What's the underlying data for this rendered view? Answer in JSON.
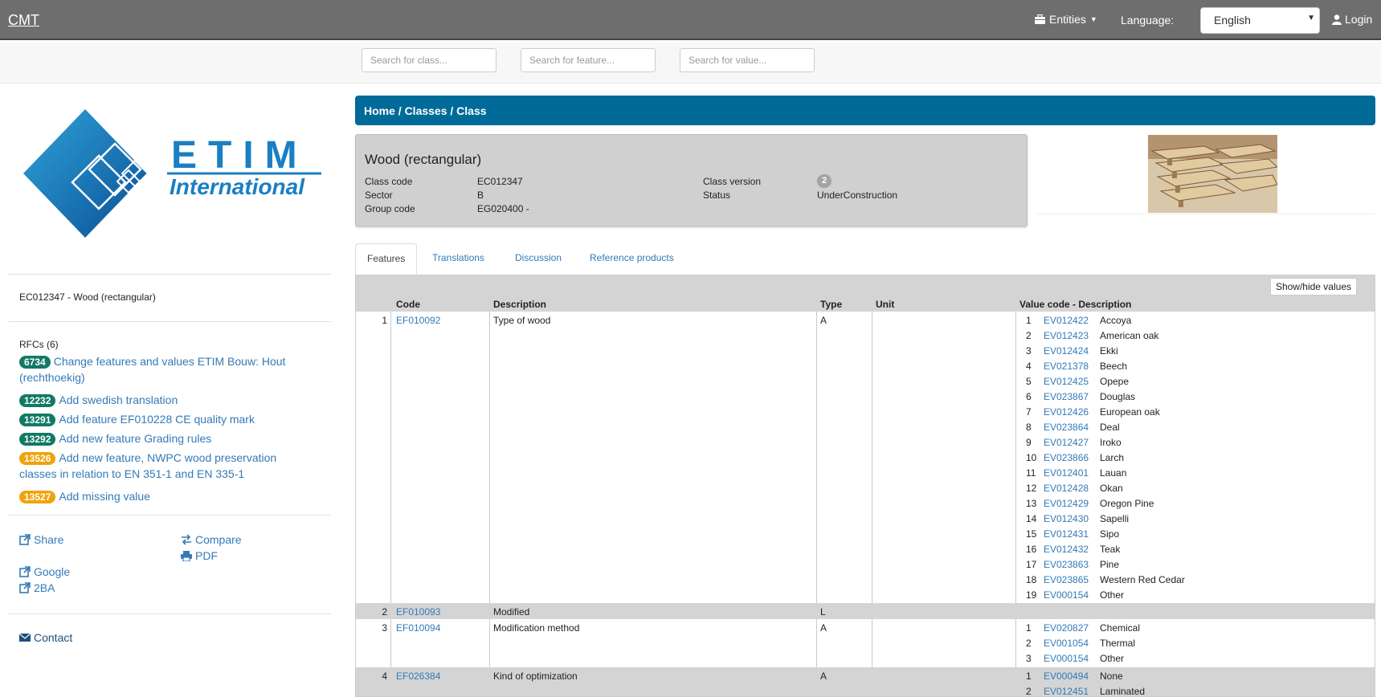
{
  "navbar": {
    "brand": "CMT",
    "entities_label": "Entities",
    "language_label": "Language:",
    "language_value": "English",
    "login_label": "Login"
  },
  "search": {
    "class_placeholder": "Search for class...",
    "feature_placeholder": "Search for feature...",
    "value_placeholder": "Search for value..."
  },
  "sidebar": {
    "logo_text_top": "ETIM",
    "logo_text_bottom": "International",
    "class_summary": "EC012347 - Wood (rectangular)",
    "rfcs_heading": "RFCs (6)",
    "rfcs": [
      {
        "id": "6734",
        "text": "Change features and values ETIM Bouw: Hout (rechthoekig)",
        "color": "#117a65"
      },
      {
        "id": "12232",
        "text": "Add swedish translation",
        "color": "#117a65"
      },
      {
        "id": "13291",
        "text": "Add feature EF010228 CE quality mark",
        "color": "#117a65"
      },
      {
        "id": "13292",
        "text": "Add new feature Grading rules",
        "color": "#117a65"
      },
      {
        "id": "13526",
        "text": "Add new feature, NWPC wood preservation classes in relation to EN 351-1 and EN 335-1",
        "color": "#f0a30a"
      },
      {
        "id": "13527",
        "text": "Add missing value",
        "color": "#f0a30a"
      }
    ],
    "links": {
      "share": "Share",
      "compare": "Compare",
      "pdf": "PDF",
      "google": "Google",
      "2ba": "2BA",
      "contact": "Contact"
    }
  },
  "breadcrumb": "Home / Classes / Class",
  "class_info": {
    "title": "Wood (rectangular)",
    "class_code_label": "Class code",
    "class_code": "EC012347",
    "sector_label": "Sector",
    "sector": "B",
    "group_code_label": "Group code",
    "group_code": "EG020400 -",
    "class_version_label": "Class version",
    "class_version": "2",
    "status_label": "Status",
    "status": "UnderConstruction"
  },
  "tabs": [
    "Features",
    "Translations",
    "Discussion",
    "Reference products"
  ],
  "table": {
    "show_hide_label": "Show/hide values",
    "headers": {
      "code": "Code",
      "description": "Description",
      "type": "Type",
      "unit": "Unit",
      "values": "Value code - Description"
    },
    "rows": [
      {
        "num": "1",
        "code": "EF010092",
        "description": "Type of wood",
        "type": "A",
        "unit": "",
        "values": [
          [
            "1",
            "EV012422",
            "Accoya"
          ],
          [
            "2",
            "EV012423",
            "American oak"
          ],
          [
            "3",
            "EV012424",
            "Ekki"
          ],
          [
            "4",
            "EV021378",
            "Beech"
          ],
          [
            "5",
            "EV012425",
            "Opepe"
          ],
          [
            "6",
            "EV023867",
            "Douglas"
          ],
          [
            "7",
            "EV012426",
            "European oak"
          ],
          [
            "8",
            "EV023864",
            "Deal"
          ],
          [
            "9",
            "EV012427",
            "Iroko"
          ],
          [
            "10",
            "EV023866",
            "Larch"
          ],
          [
            "11",
            "EV012401",
            "Lauan"
          ],
          [
            "12",
            "EV012428",
            "Okan"
          ],
          [
            "13",
            "EV012429",
            "Oregon Pine"
          ],
          [
            "14",
            "EV012430",
            "Sapelli"
          ],
          [
            "15",
            "EV012431",
            "Sipo"
          ],
          [
            "16",
            "EV012432",
            "Teak"
          ],
          [
            "17",
            "EV023863",
            "Pine"
          ],
          [
            "18",
            "EV023865",
            "Western Red Cedar"
          ],
          [
            "19",
            "EV000154",
            "Other"
          ]
        ]
      },
      {
        "num": "2",
        "code": "EF010093",
        "description": "Modified",
        "type": "L",
        "unit": "",
        "values": []
      },
      {
        "num": "3",
        "code": "EF010094",
        "description": "Modification method",
        "type": "A",
        "unit": "",
        "values": [
          [
            "1",
            "EV020827",
            "Chemical"
          ],
          [
            "2",
            "EV001054",
            "Thermal"
          ],
          [
            "3",
            "EV000154",
            "Other"
          ]
        ]
      },
      {
        "num": "4",
        "code": "EF026384",
        "description": "Kind of optimization",
        "type": "A",
        "unit": "",
        "values": [
          [
            "1",
            "EV000494",
            "None"
          ],
          [
            "2",
            "EV012451",
            "Laminated"
          ]
        ]
      }
    ]
  }
}
